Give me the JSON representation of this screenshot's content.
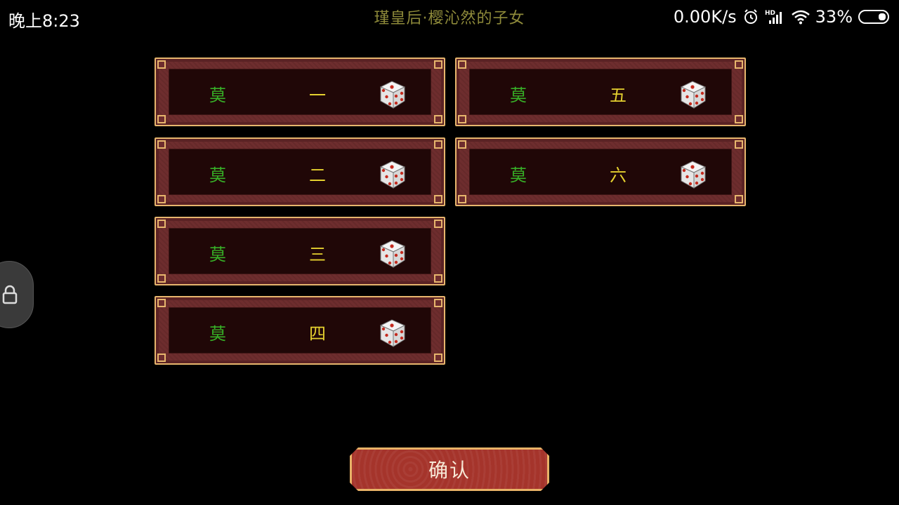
{
  "status_bar": {
    "time": "晚上8:23",
    "network_speed": "0.00K/s",
    "battery": "33%",
    "icons": [
      "alarm-icon",
      "hd-signal-icon",
      "wifi-icon",
      "battery-icon"
    ]
  },
  "title": "瑾皇后·樱沁然的子女",
  "children": [
    {
      "surname": "莫",
      "name": "一"
    },
    {
      "surname": "莫",
      "name": "二"
    },
    {
      "surname": "莫",
      "name": "三"
    },
    {
      "surname": "莫",
      "name": "四"
    },
    {
      "surname": "莫",
      "name": "五"
    },
    {
      "surname": "莫",
      "name": "六"
    }
  ],
  "confirm_label": "确认",
  "colors": {
    "surname": "#37b027",
    "name": "#e5d12f",
    "frame_border": "#e7b66d",
    "frame_bg": "#6e2d2e",
    "title": "#8e8a3a"
  }
}
